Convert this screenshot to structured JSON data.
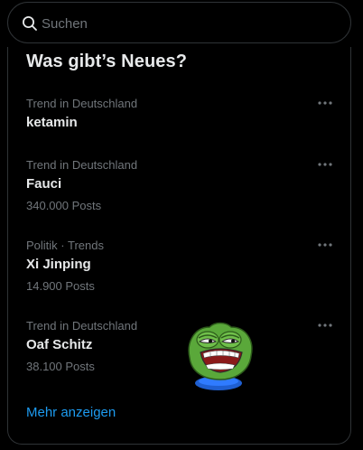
{
  "search": {
    "placeholder": "Suchen"
  },
  "trends": {
    "title": "Was gibt’s Neues?",
    "items": [
      {
        "context": "Trend in Deutschland",
        "name": "ketamin",
        "count": ""
      },
      {
        "context": "Trend in Deutschland",
        "name": "Fauci",
        "count": "340.000 Posts"
      },
      {
        "context": "Politik · Trends",
        "name": "Xi Jinping",
        "count": "14.900 Posts"
      },
      {
        "context": "Trend in Deutschland",
        "name": "Oaf Schitz",
        "count": "38.100 Posts"
      }
    ],
    "show_more": "Mehr anzeigen"
  },
  "icons": {
    "search": "search-icon",
    "more": "more-horizontal-icon",
    "sticker": "pepe-frog-icon"
  },
  "colors": {
    "background": "#000000",
    "border": "#2f3336",
    "text_primary": "#e7e9ea",
    "text_secondary": "#71767b",
    "accent": "#1d9bf0"
  }
}
